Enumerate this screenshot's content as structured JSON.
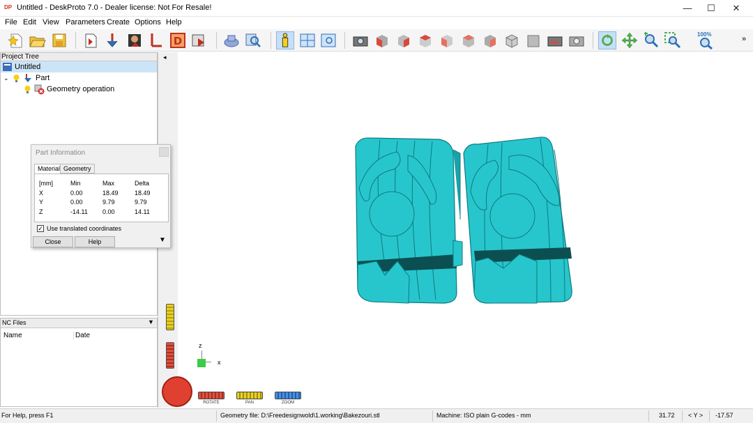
{
  "window": {
    "title": "Untitled - DeskProto 7.0 - Dealer license: Not For Resale!",
    "logo": "DP",
    "minimize": "—",
    "maximize": "☐",
    "close": "✕"
  },
  "menu": [
    "File",
    "Edit",
    "View",
    "Parameters",
    "Create",
    "Options",
    "Help"
  ],
  "toolbar": {
    "icons": [
      "new-icon",
      "open-icon",
      "save-icon",
      "import-icon",
      "part-icon",
      "image-icon",
      "vector-icon",
      "d-icon",
      "export-icon",
      "simulate-icon",
      "zoom-find-icon",
      "info-icon",
      "layout-icon",
      "view-window-icon",
      "camera-icon",
      "view-front-icon",
      "view-back-icon",
      "view-left-icon",
      "view-right-icon",
      "view-top-icon",
      "view-bottom-icon",
      "view-iso-icon",
      "view-iso2-icon",
      "camera-reset-icon",
      "camera-settings-icon",
      "rotate-icon",
      "pan-icon",
      "zoom-in-icon",
      "zoom-window-icon",
      "zoom-100-icon"
    ],
    "zoom_label": "100%",
    "more": "»"
  },
  "project_tree": {
    "title": "Project Tree",
    "items": [
      {
        "label": "Untitled",
        "level": 0
      },
      {
        "label": "Part",
        "level": 1
      },
      {
        "label": "Geometry operation",
        "level": 2
      }
    ]
  },
  "nc_files": {
    "title": "NC Files",
    "columns": [
      "Name",
      "Date"
    ]
  },
  "part_info": {
    "title": "Part Information",
    "tabs": [
      "Material",
      "Geometry"
    ],
    "headers": [
      "[mm]",
      "Min",
      "Max",
      "Delta"
    ],
    "rows": [
      {
        "axis": "X",
        "min": "0.00",
        "max": "18.49",
        "delta": "18.49"
      },
      {
        "axis": "Y",
        "min": "0.00",
        "max": "9.79",
        "delta": "9.79"
      },
      {
        "axis": "Z",
        "min": "-14.11",
        "max": "0.00",
        "delta": "14.11"
      }
    ],
    "checkbox_label": "Use translated coordinates",
    "checkbox_checked": true,
    "close_label": "Close",
    "help_label": "Help"
  },
  "viewport": {
    "axis_z": "z",
    "axis_x": "x",
    "model_color": "#27c6cc",
    "controls": [
      "ROTATE",
      "PAN",
      "ZOOM"
    ]
  },
  "status": {
    "help": "For Help, press F1",
    "geometry_file": "Geometry file: D:\\Freedesignwold\\1.working\\Bakezouri.stl",
    "machine": "Machine: ISO plain G-codes - mm",
    "coord_a": "31.72",
    "axis_label": "< Y >",
    "coord_b": "-17.57"
  }
}
